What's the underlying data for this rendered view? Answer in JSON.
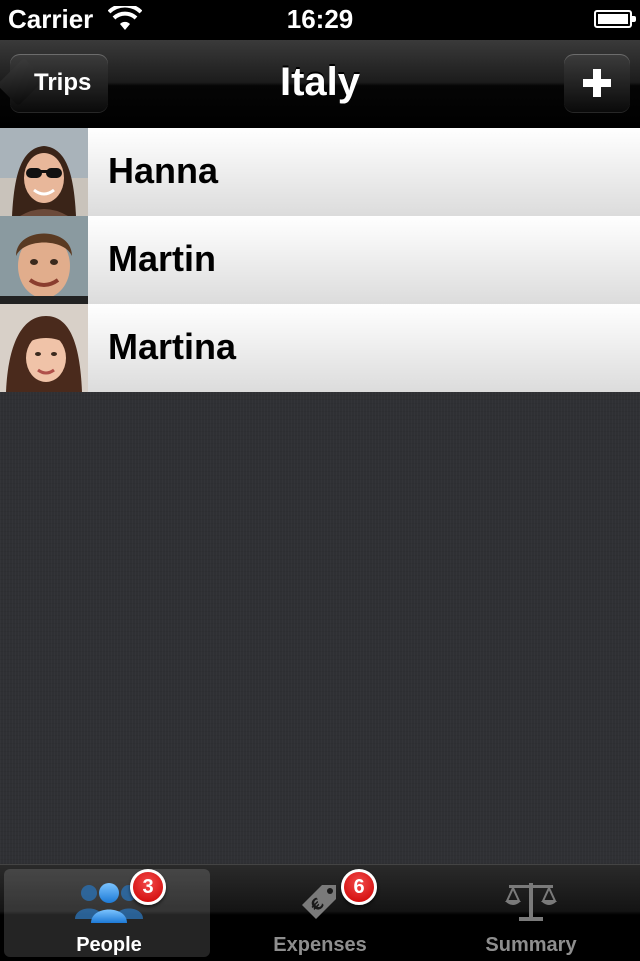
{
  "status_bar": {
    "carrier": "Carrier",
    "time": "16:29"
  },
  "nav": {
    "title": "Italy",
    "back_label": "Trips"
  },
  "people": [
    {
      "name": "Hanna"
    },
    {
      "name": "Martin"
    },
    {
      "name": "Martina"
    }
  ],
  "tabs": [
    {
      "label": "People",
      "icon": "people-icon",
      "badge": "3",
      "selected": true
    },
    {
      "label": "Expenses",
      "icon": "euro-tag-icon",
      "badge": "6",
      "selected": false
    },
    {
      "label": "Summary",
      "icon": "scales-icon",
      "badge": "",
      "selected": false
    }
  ],
  "colors": {
    "badge": "#cc0000",
    "selected_icon": "#2a8fe8"
  }
}
